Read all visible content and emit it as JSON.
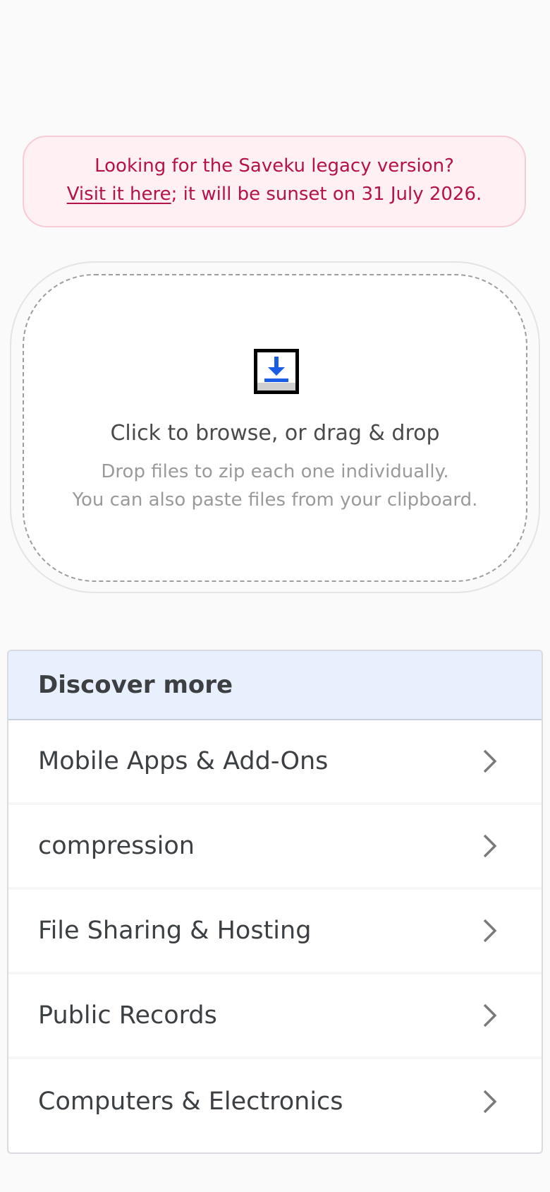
{
  "notice": {
    "line1": "Looking for the Saveku legacy version?",
    "link_text": "Visit it here",
    "line2_rest": "; it will be sunset on 31 July 2026."
  },
  "dropzone": {
    "icon": "download-icon",
    "title": "Click to browse, or drag & drop",
    "subtitle_line1": "Drop files to zip each one individually.",
    "subtitle_line2": "You can also paste files from your clipboard."
  },
  "discover": {
    "heading": "Discover more",
    "items": [
      {
        "label": "Mobile Apps & Add-Ons",
        "icon": "chevron-right-icon"
      },
      {
        "label": "compression",
        "icon": "chevron-right-icon"
      },
      {
        "label": "File Sharing & Hosting",
        "icon": "chevron-right-icon"
      },
      {
        "label": "Public Records",
        "icon": "chevron-right-icon"
      },
      {
        "label": "Computers & Electronics",
        "icon": "chevron-right-icon"
      }
    ]
  },
  "colors": {
    "notice_text": "#b5124a",
    "notice_bg": "#fff0f3",
    "accent_blue": "#1a5ce6",
    "discover_header_bg": "#e8f0fe"
  }
}
